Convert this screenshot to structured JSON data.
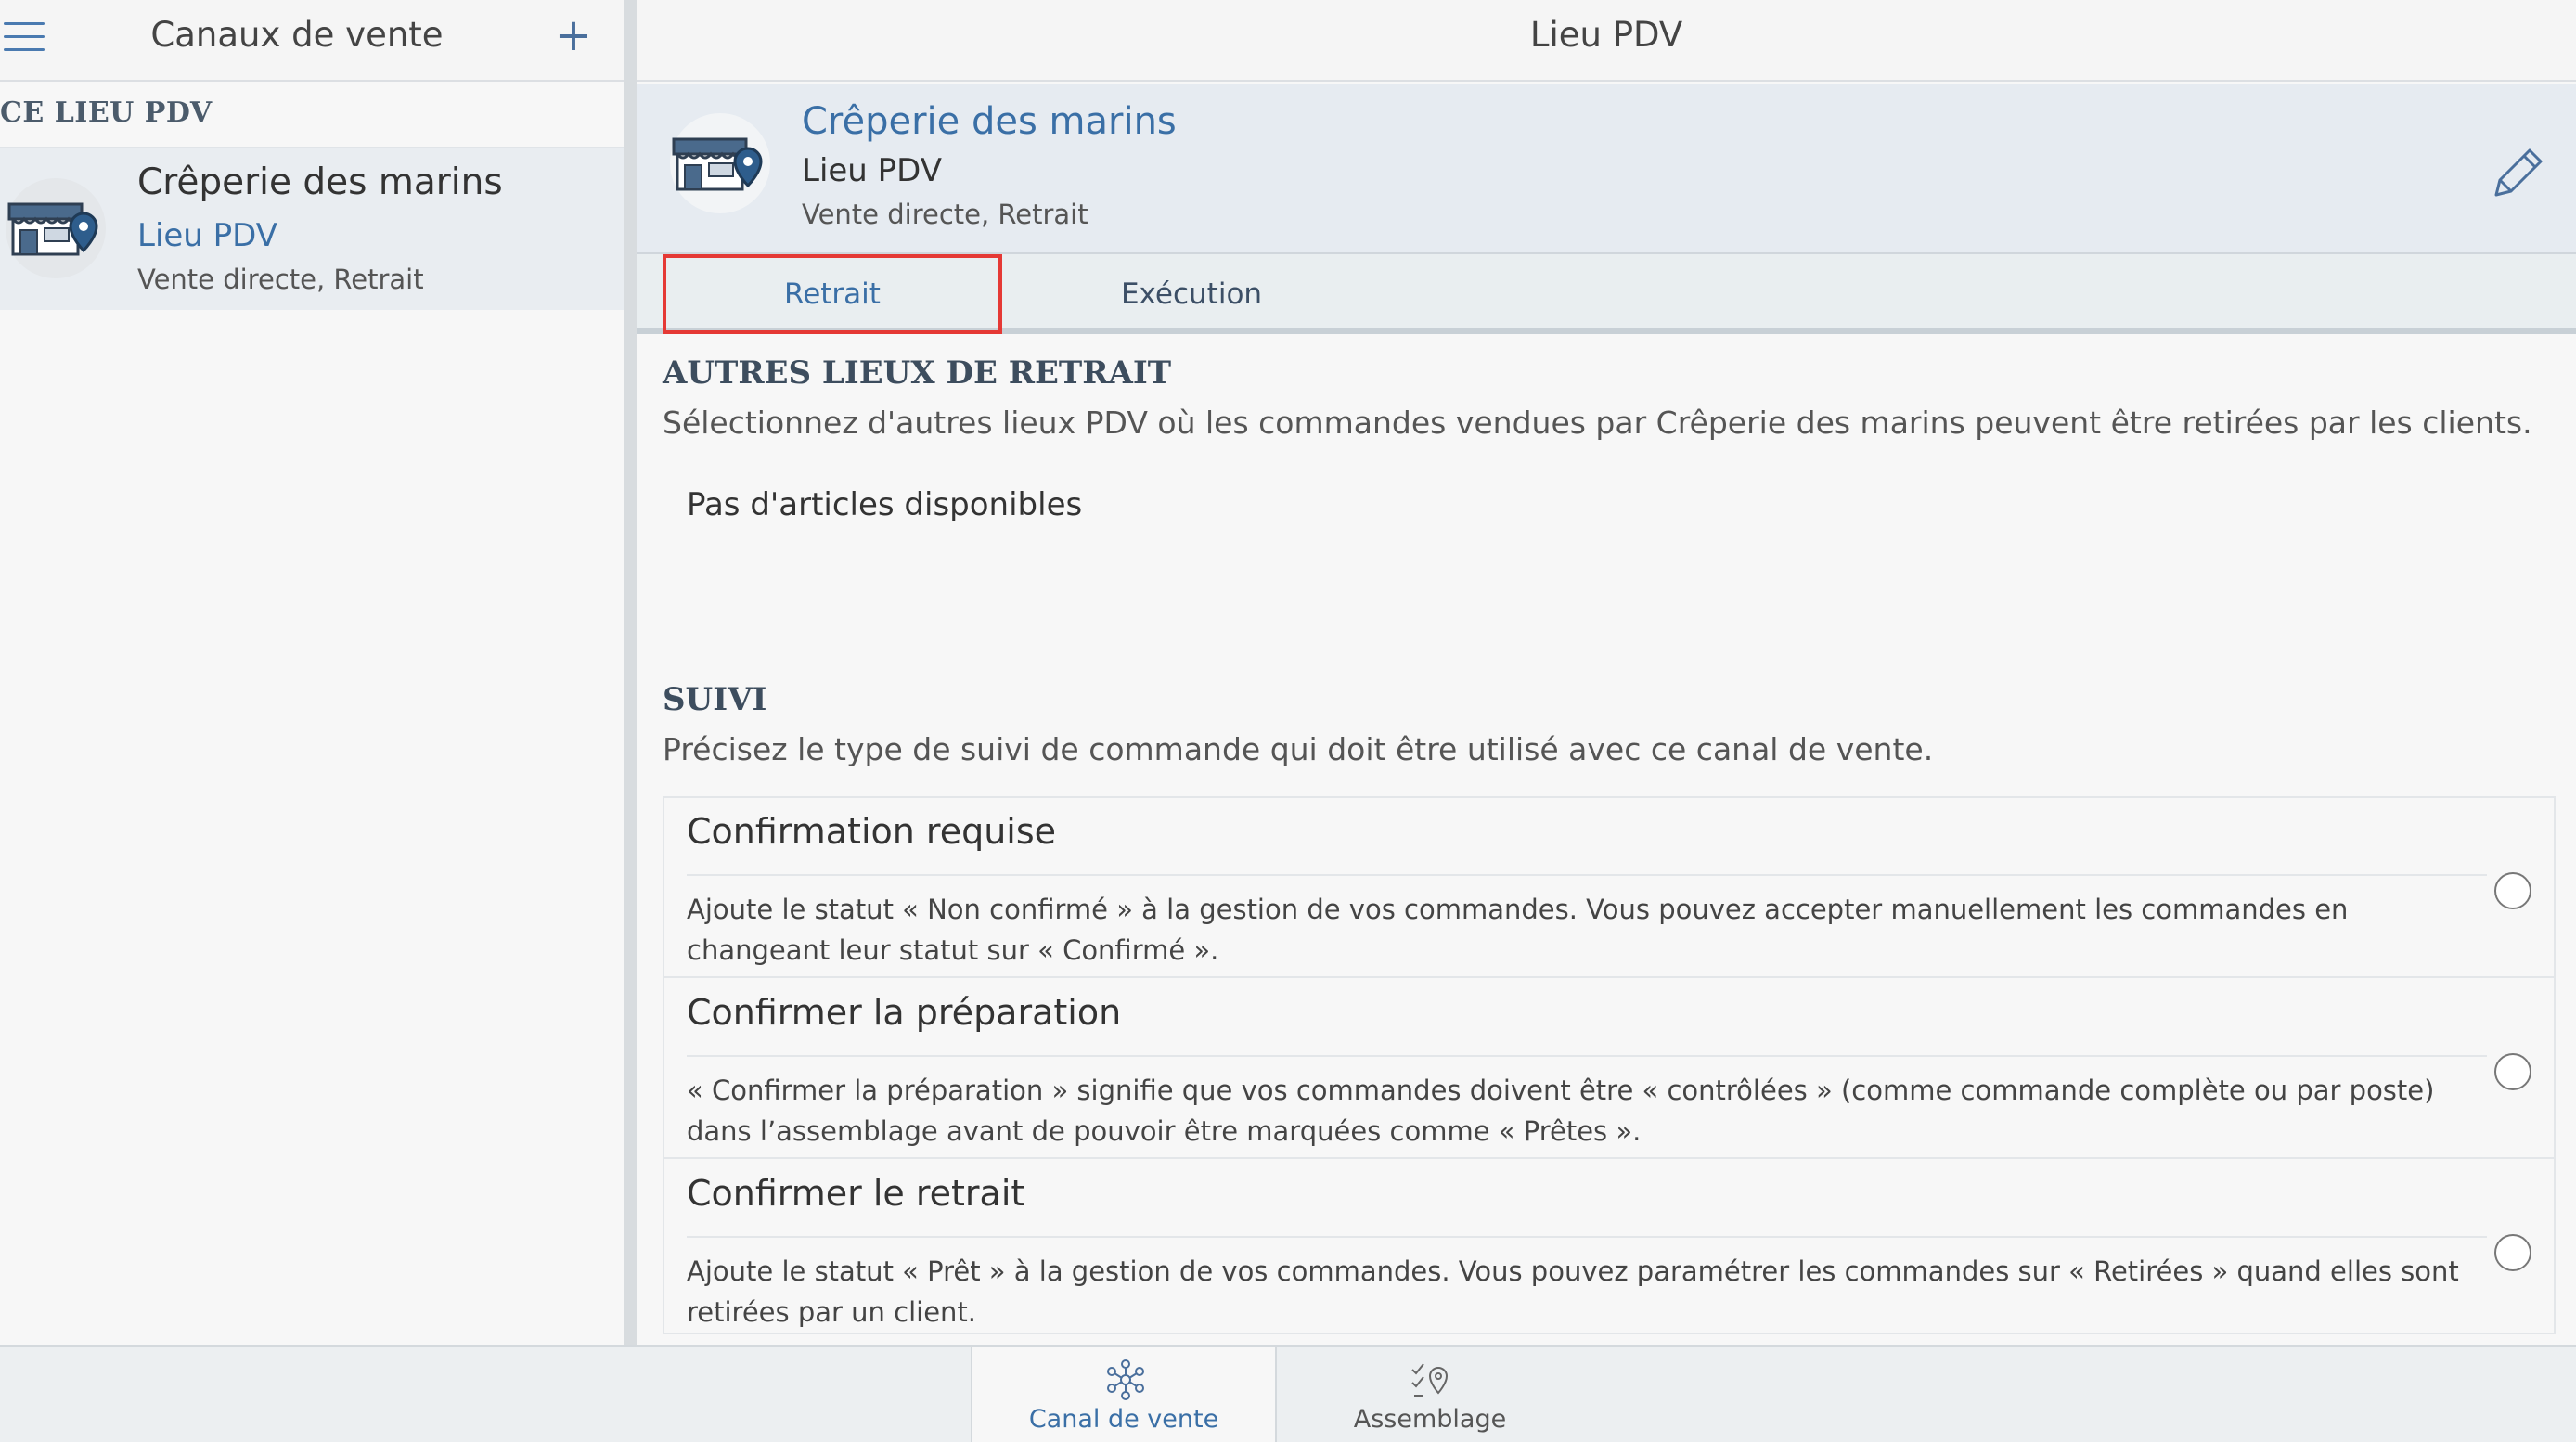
{
  "sidebar": {
    "title": "Canaux de vente",
    "add_label": "+",
    "section_label": "CE LIEU PDV",
    "item": {
      "name": "Crêperie des marins",
      "type": "Lieu PDV",
      "subtitle": "Vente directe, Retrait",
      "icon": "store-location-icon"
    }
  },
  "main": {
    "title": "Lieu PDV",
    "detail": {
      "name": "Crêperie des marins",
      "type": "Lieu PDV",
      "subtitle": "Vente directe, Retrait",
      "icon": "store-location-icon",
      "edit_icon": "pencil-icon"
    },
    "tabs": [
      {
        "label": "Retrait",
        "active": true
      },
      {
        "label": "Exécution",
        "active": false
      }
    ],
    "pickup_section": {
      "title": "AUTRES LIEUX DE RETRAIT",
      "description": "Sélectionnez d'autres lieux PDV où les commandes vendues par Crêperie des marins peuvent être retirées par les clients.",
      "empty_text": "Pas d'articles disponibles"
    },
    "tracking_section": {
      "title": "SUIVI",
      "description": "Précisez le type de suivi de commande qui doit être utilisé avec ce canal de vente.",
      "options": [
        {
          "title": "Confirmation requise",
          "description": "Ajoute le statut « Non confirmé » à la gestion de vos commandes. Vous pouvez accepter manuellement les commandes en changeant leur statut sur « Confirmé ».",
          "selected": false
        },
        {
          "title": "Confirmer la préparation",
          "description": "« Confirmer la préparation » signifie que vos commandes doivent être « contrôlées » (comme commande complète ou par poste) dans l’assemblage avant de pouvoir être marquées comme « Prêtes ».",
          "selected": false
        },
        {
          "title": "Confirmer le retrait",
          "description": "Ajoute le statut « Prêt » à la gestion de vos commandes. Vous pouvez paramétrer les commandes sur « Retirées » quand elles sont retirées par un client.",
          "selected": false
        }
      ]
    }
  },
  "bottom_nav": [
    {
      "label": "Canal de vente",
      "icon": "sales-channel-icon",
      "active": true
    },
    {
      "label": "Assemblage",
      "icon": "assembly-checklist-icon",
      "active": false
    }
  ],
  "colors": {
    "accent": "#3a6fa6",
    "highlight_border": "#e53935",
    "detail_background": "#e6ebf1",
    "sidebar_item_background": "#e9edf1"
  }
}
